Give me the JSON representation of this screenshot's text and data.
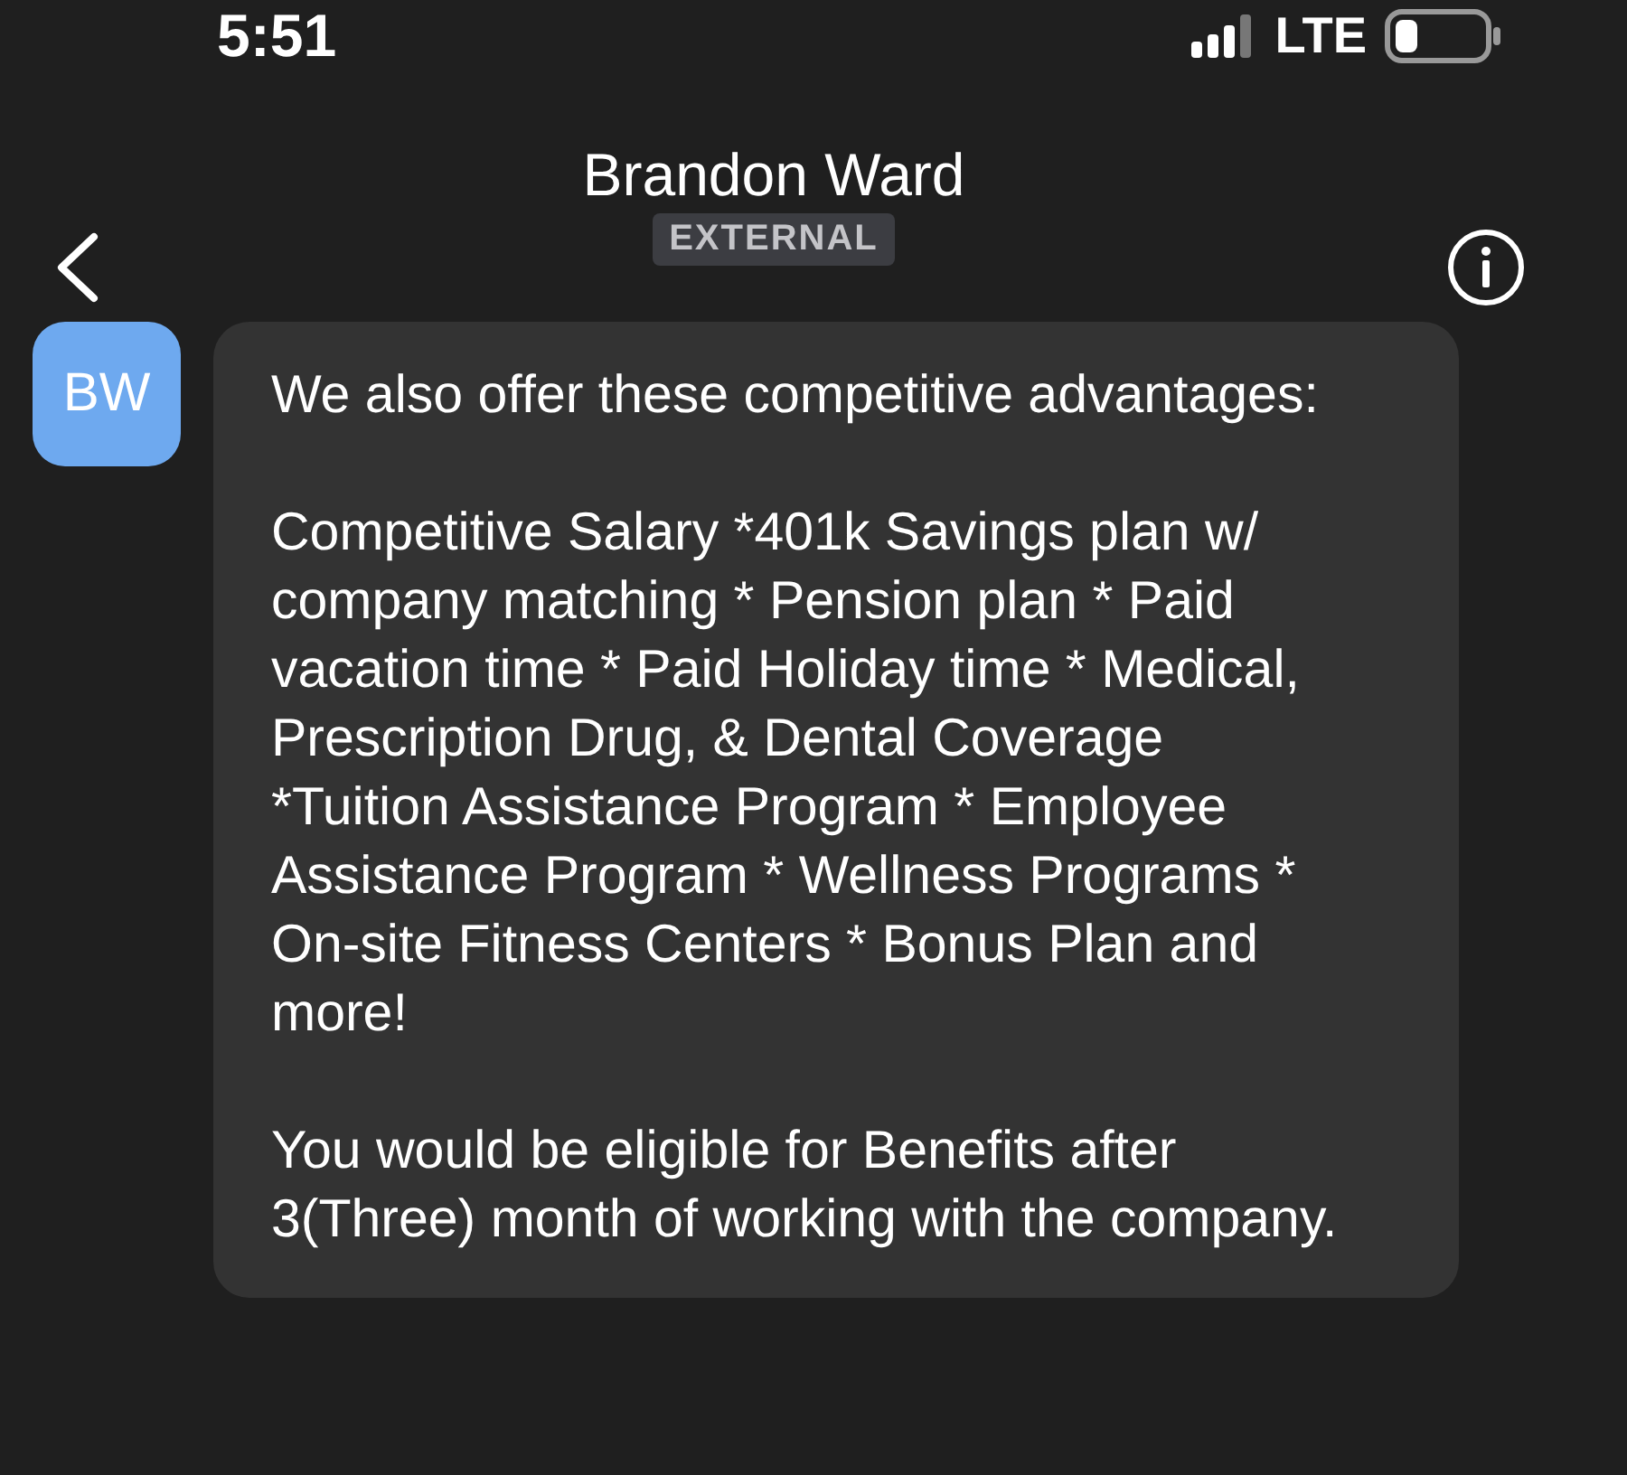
{
  "status_bar": {
    "time": "5:51",
    "network": "LTE"
  },
  "header": {
    "title": "Brandon Ward",
    "badge": "EXTERNAL"
  },
  "message": {
    "avatar": "BW",
    "paragraphs": [
      "We also offer these competitive advantages:",
      "Competitive Salary *401k Savings plan w/ company matching * Pension plan * Paid vacation time * Paid Holiday time * Medical, Prescription Drug, & Dental Coverage *Tuition Assistance Program * Employee Assistance Program * Wellness Programs * On-site Fitness Centers * Bonus Plan and more!",
      "You would be eligible for Benefits after 3(Three) month of working with the company."
    ]
  }
}
